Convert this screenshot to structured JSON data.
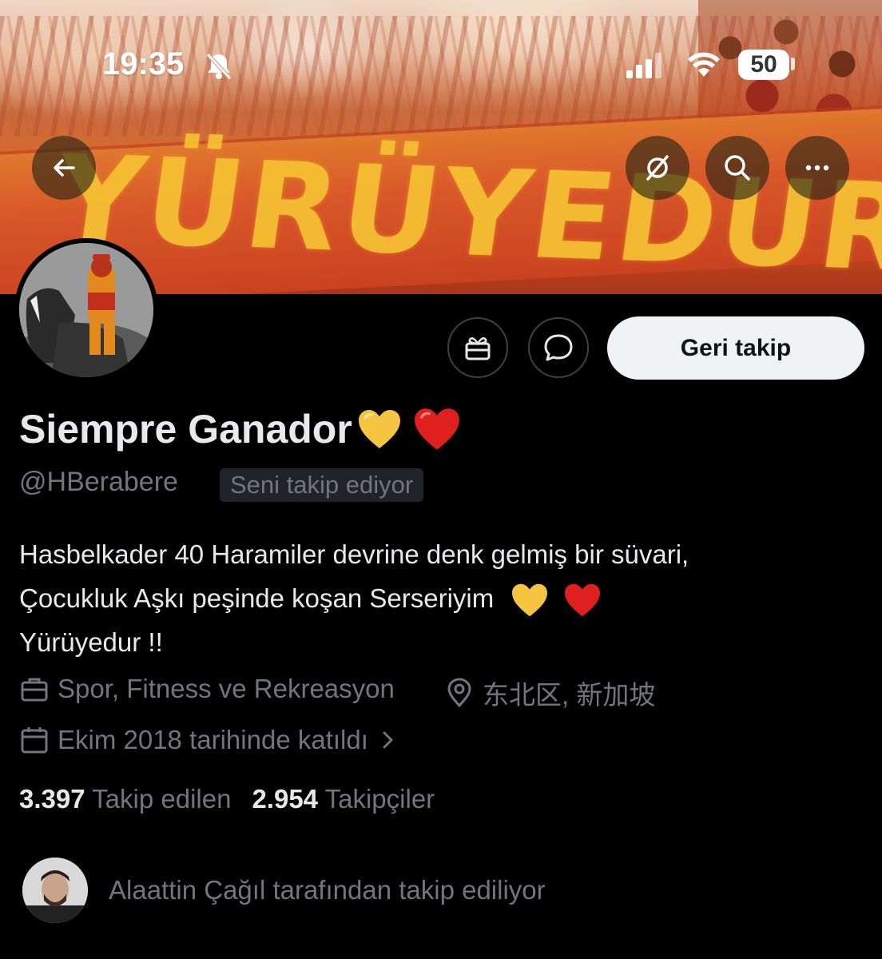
{
  "status_bar": {
    "time": "19:35",
    "battery": "50"
  },
  "banner": {
    "flag_text": "YÜRÜYEDUR !"
  },
  "header_buttons": {
    "back_icon": "arrow-left-icon",
    "grok_icon": "grok-icon",
    "search_icon": "search-icon",
    "more_icon": "more-horizontal-icon"
  },
  "profile": {
    "display_name": "Siempre Ganador",
    "handle": "@HBerabere",
    "follows_you_badge": "Seni takip ediyor",
    "bio_lines": [
      "Hasbelkader 40 Haramiler devrine denk gelmiş bir süvari,",
      "Çocukluk Aşkı peşinde koşan Serseriyim",
      "Yürüyedur !!"
    ],
    "category": "Spor, Fitness ve Rekreasyon",
    "location": "东北区, 新加坡",
    "joined": "Ekim 2018 tarihinde katıldı",
    "following_count": "3.397",
    "following_label": "Takip edilen",
    "followers_count": "2.954",
    "followers_label": "Takipçiler",
    "followed_by": "Alaattin Çağıl tarafından takip ediliyor"
  },
  "actions": {
    "gift_icon": "gift-icon",
    "dm_icon": "message-icon",
    "follow_button": "Geri takip"
  },
  "colors": {
    "background": "#000000",
    "primary_text": "#e7e9ea",
    "secondary_text": "#71767b",
    "button_bg": "#eff3f4",
    "yellow_heart": "#f5c542",
    "red_heart": "#e0201e"
  }
}
